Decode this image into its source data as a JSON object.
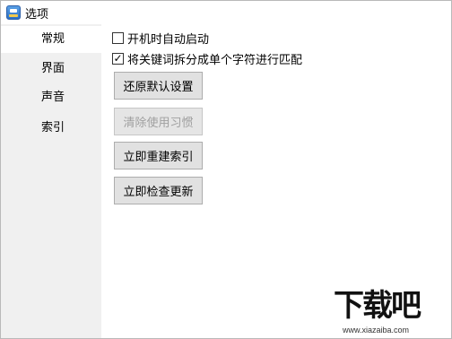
{
  "window": {
    "title": "选项"
  },
  "sidebar": {
    "items": [
      {
        "label": "常规",
        "active": true
      },
      {
        "label": "界面",
        "active": false
      },
      {
        "label": "声音",
        "active": false
      },
      {
        "label": "索引",
        "active": false
      }
    ]
  },
  "general": {
    "checkboxes": [
      {
        "label": "开机时自动启动",
        "checked": false
      },
      {
        "label": "将关键词拆分成单个字符进行匹配",
        "checked": true
      }
    ],
    "buttons": [
      {
        "label": "还原默认设置",
        "enabled": true
      },
      {
        "label": "清除使用习惯",
        "enabled": false
      },
      {
        "label": "立即重建索引",
        "enabled": true
      },
      {
        "label": "立即检查更新",
        "enabled": true
      }
    ]
  },
  "watermark": {
    "logo_text": "下载吧",
    "url": "www.xiazaiba.com"
  },
  "colors": {
    "sidebar_bg": "#f0f0f0",
    "button_bg": "#e1e1e1",
    "disabled_text": "#a0a0a0"
  }
}
